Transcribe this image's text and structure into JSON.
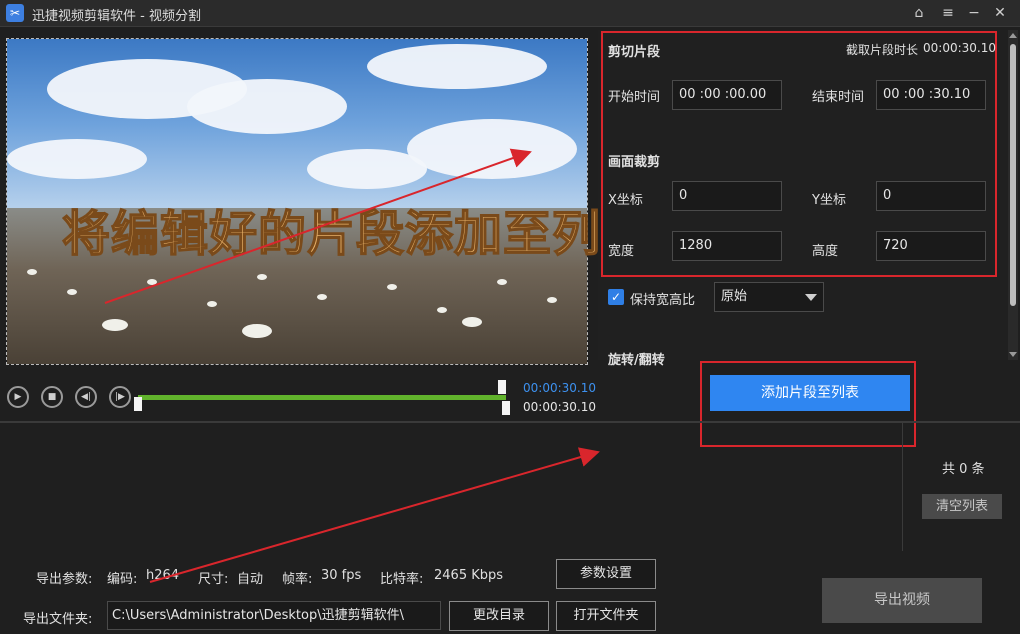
{
  "window": {
    "title": "迅捷视频剪辑软件 - 视频分割",
    "icon": "scissors-icon",
    "controls": [
      "home-icon",
      "menu-icon",
      "minimize-icon",
      "close-icon"
    ]
  },
  "preview": {
    "overlay_caption": "将编辑好的片段添加至列表"
  },
  "clip": {
    "section_title": "剪切片段",
    "duration_label": "截取片段时长",
    "duration_value": "00:00:30.10",
    "start_label": "开始时间",
    "start_value": "00 :00 :00.00",
    "end_label": "结束时间",
    "end_value": "00 :00 :30.10"
  },
  "crop": {
    "section_title": "画面裁剪",
    "x_label": "X坐标",
    "x_value": "0",
    "y_label": "Y坐标",
    "y_value": "0",
    "width_label": "宽度",
    "width_value": "1280",
    "height_label": "高度",
    "height_value": "720",
    "keep_ratio_label": "保持宽高比",
    "keep_ratio_checked": true,
    "ratio_selected": "原始"
  },
  "rotate": {
    "section_title": "旋转/翻转"
  },
  "playback": {
    "current_time": "00:00:30.10",
    "total_time": "00:00:30.10",
    "selection_fraction": 1.0
  },
  "actions": {
    "add_to_list": "添加片段至列表",
    "list_count": "共 0 条",
    "clear_list": "清空列表",
    "export_video": "导出视频"
  },
  "export": {
    "params_label": "导出参数:",
    "codec_label": "编码:",
    "codec_value": "h264",
    "size_label": "尺寸:",
    "size_value": "自动",
    "fps_label": "帧率:",
    "fps_value": "30 fps",
    "bitrate_label": "比特率:",
    "bitrate_value": "2465 Kbps",
    "settings_button": "参数设置",
    "folder_label": "导出文件夹:",
    "folder_path": "C:\\Users\\Administrator\\Desktop\\迅捷剪辑软件\\",
    "change_dir_button": "更改目录",
    "open_folder_button": "打开文件夹"
  },
  "colors": {
    "accent_blue": "#2f86f1",
    "highlight_red": "#d9262c",
    "timeline_green": "#61b32c",
    "time_blue": "#3d91ef"
  }
}
